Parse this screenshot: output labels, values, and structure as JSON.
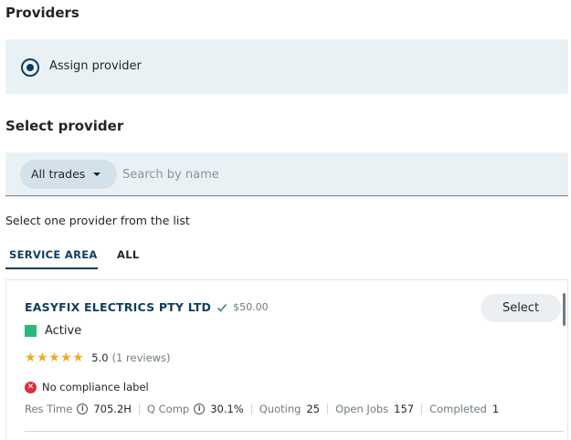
{
  "providers": {
    "title": "Providers"
  },
  "assign": {
    "label": "Assign provider",
    "selected": true
  },
  "select_provider": {
    "title": "Select provider"
  },
  "search": {
    "trades_label": "All trades",
    "placeholder": "Search by name"
  },
  "instruction": "Select one provider from the list",
  "tabs": [
    {
      "label": "SERVICE AREA",
      "active": true
    },
    {
      "label": "ALL",
      "active": false
    }
  ],
  "provider": {
    "name": "EASYFIX ELECTRICS PTY LTD",
    "verified_icon": "check-icon",
    "price": "$50.00",
    "select_label": "Select",
    "status": "Active",
    "stars": "★★★★★",
    "rating": "5.0",
    "reviews": "(1 reviews)",
    "compliance": "No compliance label",
    "stats": {
      "res_time_label": "Res Time",
      "res_time_value": "705.2H",
      "q_comp_label": "Q Comp",
      "q_comp_value": "30.1%",
      "quoting_label": "Quoting",
      "quoting_value": "25",
      "open_jobs_label": "Open Jobs",
      "open_jobs_value": "157",
      "completed_label": "Completed",
      "completed_value": "1"
    }
  },
  "colors": {
    "primary": "#0f3e5c",
    "panel_bg": "#eaf1f5",
    "status_active": "#2cb87d",
    "star": "#f2a81d",
    "error": "#d9303a"
  }
}
